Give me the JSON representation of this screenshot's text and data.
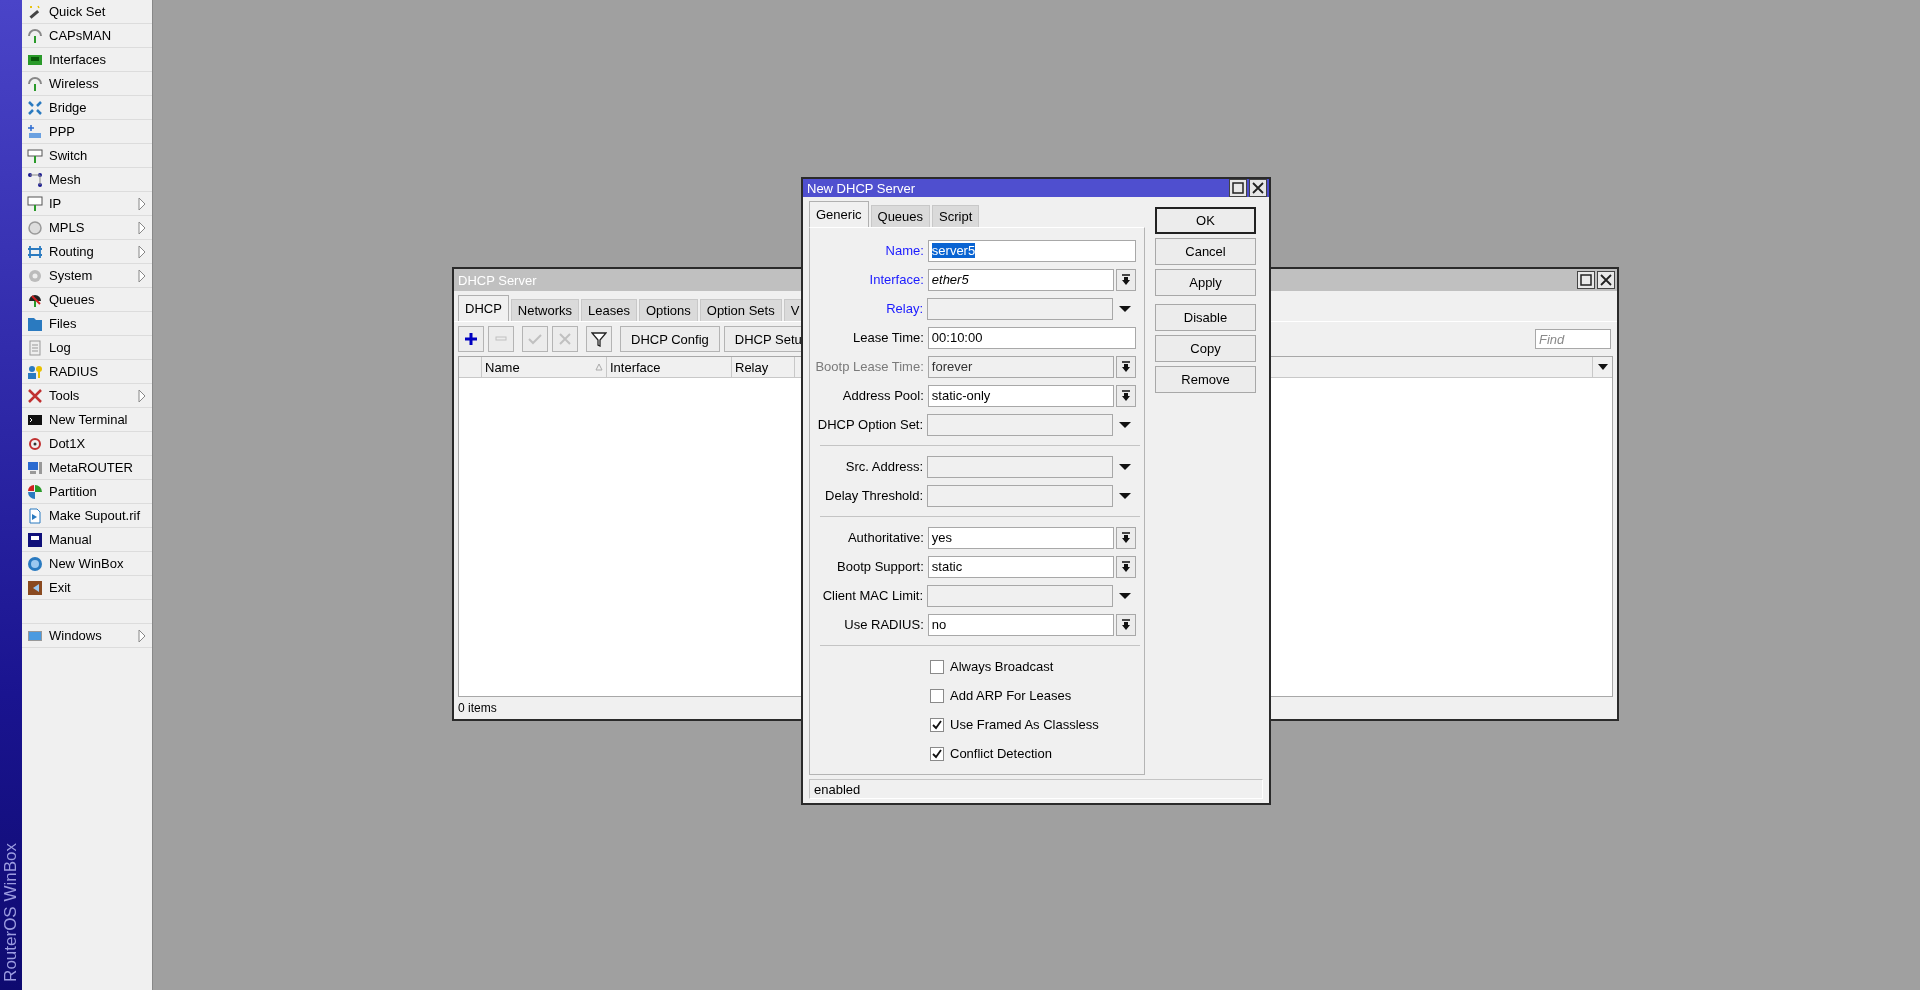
{
  "sidebar": {
    "brand": "RouterOS WinBox",
    "items": [
      {
        "label": "Quick Set",
        "submenu": false,
        "gap_before": false
      },
      {
        "label": "CAPsMAN",
        "submenu": false,
        "gap_before": false
      },
      {
        "label": "Interfaces",
        "submenu": false,
        "gap_before": false
      },
      {
        "label": "Wireless",
        "submenu": false,
        "gap_before": false
      },
      {
        "label": "Bridge",
        "submenu": false,
        "gap_before": false
      },
      {
        "label": "PPP",
        "submenu": false,
        "gap_before": false
      },
      {
        "label": "Switch",
        "submenu": false,
        "gap_before": false
      },
      {
        "label": "Mesh",
        "submenu": false,
        "gap_before": false
      },
      {
        "label": "IP",
        "submenu": true,
        "gap_before": false
      },
      {
        "label": "MPLS",
        "submenu": true,
        "gap_before": false
      },
      {
        "label": "Routing",
        "submenu": true,
        "gap_before": false
      },
      {
        "label": "System",
        "submenu": true,
        "gap_before": false
      },
      {
        "label": "Queues",
        "submenu": false,
        "gap_before": false
      },
      {
        "label": "Files",
        "submenu": false,
        "gap_before": false
      },
      {
        "label": "Log",
        "submenu": false,
        "gap_before": false
      },
      {
        "label": "RADIUS",
        "submenu": false,
        "gap_before": false
      },
      {
        "label": "Tools",
        "submenu": true,
        "gap_before": false
      },
      {
        "label": "New Terminal",
        "submenu": false,
        "gap_before": false
      },
      {
        "label": "Dot1X",
        "submenu": false,
        "gap_before": false
      },
      {
        "label": "MetaROUTER",
        "submenu": false,
        "gap_before": false
      },
      {
        "label": "Partition",
        "submenu": false,
        "gap_before": false
      },
      {
        "label": "Make Supout.rif",
        "submenu": false,
        "gap_before": false
      },
      {
        "label": "Manual",
        "submenu": false,
        "gap_before": false
      },
      {
        "label": "New WinBox",
        "submenu": false,
        "gap_before": false
      },
      {
        "label": "Exit",
        "submenu": false,
        "gap_before": false
      },
      {
        "label": "Windows",
        "submenu": true,
        "gap_before": true
      }
    ]
  },
  "dhcp_window": {
    "title": "DHCP Server",
    "active": false,
    "tabs": [
      {
        "label": "DHCP",
        "selected": true
      },
      {
        "label": "Networks",
        "selected": false
      },
      {
        "label": "Leases",
        "selected": false
      },
      {
        "label": "Options",
        "selected": false
      },
      {
        "label": "Option Sets",
        "selected": false
      },
      {
        "label": "V",
        "selected": false
      }
    ],
    "tools": [
      {
        "kind": "add",
        "disabled": false
      },
      {
        "kind": "remove",
        "disabled": true
      },
      {
        "kind": "enable",
        "disabled": true
      },
      {
        "kind": "disable",
        "disabled": true
      },
      {
        "kind": "filter",
        "disabled": false
      }
    ],
    "text_buttons": [
      "DHCP Config",
      "DHCP Setu"
    ],
    "find": {
      "placeholder": "Find"
    },
    "table": {
      "columns": [
        {
          "label": "Name",
          "sorted": true
        },
        {
          "label": "Interface",
          "sorted": false
        },
        {
          "label": "Relay",
          "sorted": false
        }
      ]
    },
    "status": "0 items"
  },
  "dialog": {
    "title": "New DHCP Server",
    "active": true,
    "tabs": [
      {
        "label": "Generic",
        "selected": true
      },
      {
        "label": "Queues",
        "selected": false
      },
      {
        "label": "Script",
        "selected": false
      }
    ],
    "rows": [
      {
        "kind": "text",
        "label": "Name:",
        "linked": true,
        "disabled": false,
        "value": "server5",
        "value_selected": true
      },
      {
        "kind": "combo",
        "label": "Interface:",
        "linked": true,
        "disabled": false,
        "value": "ether5",
        "value_italic": true
      },
      {
        "kind": "dropdown",
        "label": "Relay:",
        "linked": true,
        "disabled": false
      },
      {
        "kind": "text",
        "label": "Lease Time:",
        "linked": false,
        "disabled": false,
        "value": "00:10:00"
      },
      {
        "kind": "combo",
        "label": "Bootp Lease Time:",
        "linked": false,
        "disabled": true,
        "value": "forever"
      },
      {
        "kind": "combo",
        "label": "Address Pool:",
        "linked": false,
        "disabled": false,
        "value": "static-only"
      },
      {
        "kind": "dropdown",
        "label": "DHCP Option Set:",
        "linked": false,
        "disabled": false
      },
      {
        "kind": "separator"
      },
      {
        "kind": "dropdown",
        "label": "Src. Address:",
        "linked": false,
        "disabled": false
      },
      {
        "kind": "dropdown",
        "label": "Delay Threshold:",
        "linked": false,
        "disabled": false
      },
      {
        "kind": "separator"
      },
      {
        "kind": "combo",
        "label": "Authoritative:",
        "linked": false,
        "disabled": false,
        "value": "yes"
      },
      {
        "kind": "combo",
        "label": "Bootp Support:",
        "linked": false,
        "disabled": false,
        "value": "static"
      },
      {
        "kind": "dropdown",
        "label": "Client MAC Limit:",
        "linked": false,
        "disabled": false
      },
      {
        "kind": "combo",
        "label": "Use RADIUS:",
        "linked": false,
        "disabled": false,
        "value": "no"
      },
      {
        "kind": "separator"
      },
      {
        "kind": "checkbox",
        "label": "Always Broadcast",
        "checked": false
      },
      {
        "kind": "checkbox",
        "label": "Add ARP For Leases",
        "checked": false
      },
      {
        "kind": "checkbox",
        "label": "Use Framed As Classless",
        "checked": true
      },
      {
        "kind": "checkbox",
        "label": "Conflict Detection",
        "checked": true
      }
    ],
    "button_groups": [
      {
        "buttons": [
          {
            "label": "OK",
            "default": true
          },
          {
            "label": "Cancel",
            "default": false
          },
          {
            "label": "Apply",
            "default": false
          }
        ]
      },
      {
        "buttons": [
          {
            "label": "Disable",
            "default": false
          },
          {
            "label": "Copy",
            "default": false
          },
          {
            "label": "Remove",
            "default": false
          }
        ]
      }
    ],
    "status": "enabled"
  }
}
